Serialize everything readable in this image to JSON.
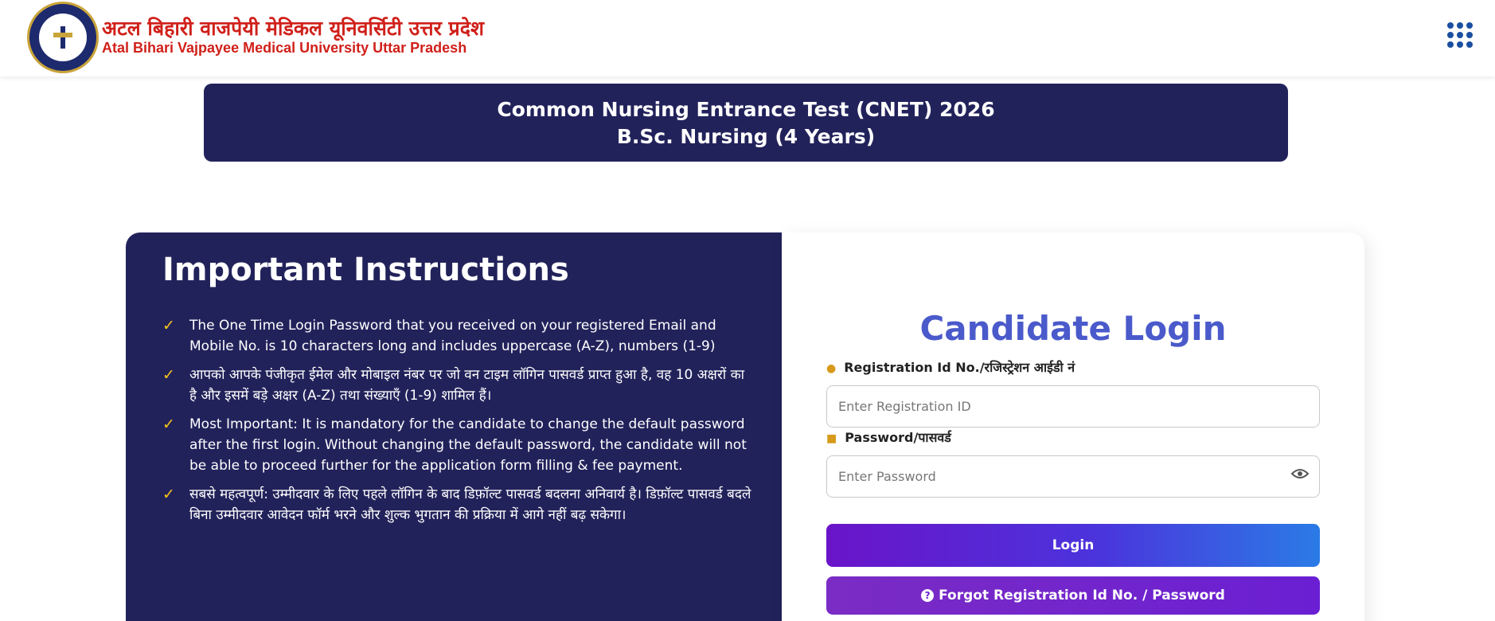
{
  "header": {
    "brand_hindi": "अटल बिहारी वाजपेयी मेडिकल यूनिवर्सिटी उत्तर प्रदेश",
    "brand_english": "Atal Bihari Vajpayee Medical University Uttar Pradesh",
    "logo_icon": "university-seal",
    "menu_icon": "grid-menu-icon",
    "brand_color": "#d0201a",
    "menu_color": "#1a4fa0"
  },
  "banner": {
    "title": "Common Nursing Entrance Test (CNET) 2026",
    "subtitle": "B.Sc. Nursing (4 Years)",
    "background": "#22225b"
  },
  "instructions": {
    "heading": "Important Instructions",
    "bullet_icon": "check-icon",
    "bullet_color": "#f5c518",
    "items": [
      "The One Time Login Password that you received on your registered Email and Mobile No. is 10 characters long and includes uppercase (A-Z), numbers (1-9)",
      "आपको आपके पंजीकृत ईमेल और मोबाइल नंबर पर जो वन टाइम लॉगिन पासवर्ड प्राप्त हुआ है, वह 10 अक्षरों का है और इसमें बड़े अक्षर (A-Z) तथा संख्याएँ (1-9) शामिल हैं।",
      "Most Important: It is mandatory for the candidate to change the default password after the first login. Without changing the default password, the candidate will not be able to proceed further for the application form filling & fee payment.",
      "सबसे महत्वपूर्ण: उम्मीदवार के लिए पहले लॉगिन के बाद डिफ़ॉल्ट पासवर्ड बदलना अनिवार्य है। डिफ़ॉल्ट पासवर्ड बदले बिना उम्मीदवार आवेदन फॉर्म भरने और शुल्क भुगतान की प्रक्रिया में आगे नहीं बढ़ सकेगा।"
    ]
  },
  "login": {
    "heading": "Candidate Login",
    "heading_color": "#4a5acb",
    "registration_label": "Registration Id No./रजिस्ट्रेशन आईडी नं",
    "registration_placeholder": "Enter Registration ID",
    "registration_value": "",
    "password_label": "Password/पासवर्ड",
    "password_placeholder": "Enter Password",
    "password_value": "",
    "login_button": "Login",
    "forgot_button": "Forgot Registration Id No. / Password",
    "user_icon": "user-icon",
    "lock_icon": "lock-icon",
    "eye_icon": "eye-icon",
    "question_icon": "question-circle-icon"
  }
}
